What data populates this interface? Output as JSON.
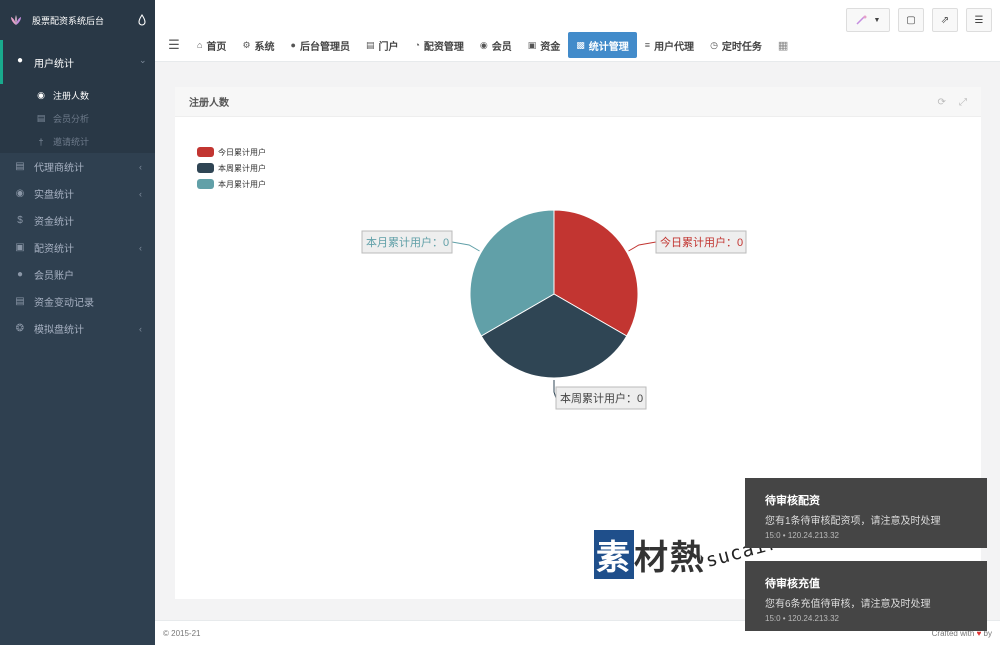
{
  "brand": {
    "title": "股票配资系统后台"
  },
  "sidebar": {
    "items": [
      {
        "label": "用户统计",
        "icon": "user-icon"
      },
      {
        "label": "代理商统计",
        "icon": "list-icon"
      },
      {
        "label": "实盘统计",
        "icon": "eye-icon"
      },
      {
        "label": "资金统计",
        "icon": "dollar-icon"
      },
      {
        "label": "配资统计",
        "icon": "card-icon"
      },
      {
        "label": "会员账户",
        "icon": "user-icon"
      },
      {
        "label": "资金变动记录",
        "icon": "money-icon"
      },
      {
        "label": "模拟盘统计",
        "icon": "ship-wheel-icon"
      }
    ],
    "sub_items": [
      {
        "label": "注册人数",
        "icon": "users-icon"
      },
      {
        "label": "会员分析",
        "icon": "film-icon"
      },
      {
        "label": "邀请统计",
        "icon": "mic-icon"
      }
    ]
  },
  "topnav": {
    "tabs": [
      {
        "label": "首页",
        "icon": "home-icon"
      },
      {
        "label": "系统",
        "icon": "gear-icon"
      },
      {
        "label": "后台管理员",
        "icon": "user-icon"
      },
      {
        "label": "门户",
        "icon": "newspaper-icon"
      },
      {
        "label": "配资管理",
        "icon": "pie-icon"
      },
      {
        "label": "会员",
        "icon": "users-icon"
      },
      {
        "label": "资金",
        "icon": "money-icon"
      },
      {
        "label": "统计管理",
        "icon": "bar-chart-icon"
      },
      {
        "label": "用户代理",
        "icon": "sitemap-icon"
      },
      {
        "label": "定时任务",
        "icon": "clock-icon"
      }
    ]
  },
  "panel": {
    "title": "注册人数"
  },
  "chart_data": {
    "type": "pie",
    "categories": [
      "今日累计用户",
      "本周累计用户",
      "本月累计用户"
    ],
    "values": [
      0,
      0,
      0
    ],
    "colors": [
      "#c23531",
      "#2f4554",
      "#61a0a8"
    ],
    "legend": "top-left",
    "labels": [
      "今日累计用户：0",
      "本周累计用户：0",
      "本月累计用户：0"
    ]
  },
  "footer": {
    "copyright": "© 2015-21",
    "credit_prefix": "Crafted with",
    "credit_suffix": "by"
  },
  "toasts": [
    {
      "title": "待审核配资",
      "message": "您有1条待审核配资项，请注意及时处理",
      "meta": "15:0 • 120.24.213.32"
    },
    {
      "title": "待审核充值",
      "message": "您有6条充值待审核，请注意及时处理",
      "meta": "15:0 • 120.24.213.32"
    }
  ],
  "watermark": {
    "zh": "素材熱",
    "en": "sucaire.com"
  }
}
